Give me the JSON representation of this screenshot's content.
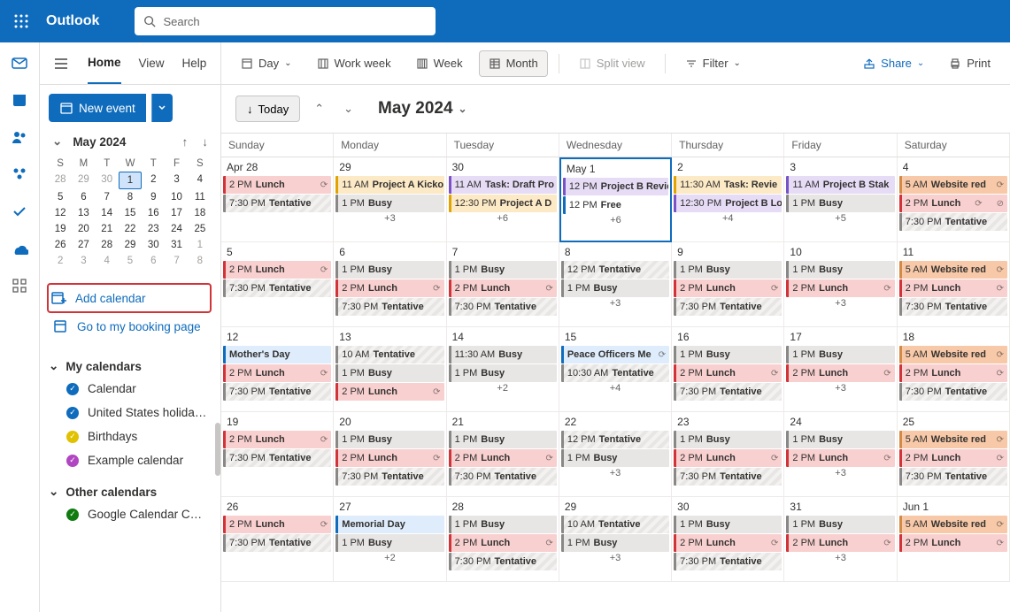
{
  "header": {
    "app_name": "Outlook",
    "search_placeholder": "Search"
  },
  "tabs": {
    "home": "Home",
    "view": "View",
    "help": "Help"
  },
  "side": {
    "new_event": "New event",
    "mini_title": "May 2024",
    "dow": [
      "S",
      "M",
      "T",
      "W",
      "T",
      "F",
      "S"
    ],
    "mini_days": [
      {
        "n": "28",
        "o": true
      },
      {
        "n": "29",
        "o": true
      },
      {
        "n": "30",
        "o": true
      },
      {
        "n": "1",
        "t": true
      },
      {
        "n": "2"
      },
      {
        "n": "3"
      },
      {
        "n": "4"
      },
      {
        "n": "5"
      },
      {
        "n": "6"
      },
      {
        "n": "7"
      },
      {
        "n": "8"
      },
      {
        "n": "9"
      },
      {
        "n": "10"
      },
      {
        "n": "11"
      },
      {
        "n": "12"
      },
      {
        "n": "13"
      },
      {
        "n": "14"
      },
      {
        "n": "15"
      },
      {
        "n": "16"
      },
      {
        "n": "17"
      },
      {
        "n": "18"
      },
      {
        "n": "19"
      },
      {
        "n": "20"
      },
      {
        "n": "21"
      },
      {
        "n": "22"
      },
      {
        "n": "23"
      },
      {
        "n": "24"
      },
      {
        "n": "25"
      },
      {
        "n": "26"
      },
      {
        "n": "27"
      },
      {
        "n": "28"
      },
      {
        "n": "29"
      },
      {
        "n": "30"
      },
      {
        "n": "31"
      },
      {
        "n": "1",
        "o": true
      },
      {
        "n": "2",
        "o": true
      },
      {
        "n": "3",
        "o": true
      },
      {
        "n": "4",
        "o": true
      },
      {
        "n": "5",
        "o": true
      },
      {
        "n": "6",
        "o": true
      },
      {
        "n": "7",
        "o": true
      },
      {
        "n": "8",
        "o": true
      }
    ],
    "add_calendar": "Add calendar",
    "booking": "Go to my booking page",
    "my_cal_head": "My calendars",
    "cals": [
      {
        "label": "Calendar",
        "color": "#0F6CBD",
        "checked": true
      },
      {
        "label": "United States holida…",
        "color": "#0F6CBD",
        "checked": true
      },
      {
        "label": "Birthdays",
        "color": "#e0c200",
        "checked": true
      },
      {
        "label": "Example calendar",
        "color": "#b146c2",
        "checked": true
      }
    ],
    "other_cal_head": "Other calendars",
    "other": [
      {
        "label": "Google Calendar C…",
        "color": "#107c10",
        "checked": true
      }
    ]
  },
  "toolbar": {
    "day": "Day",
    "work_week": "Work week",
    "week": "Week",
    "month": "Month",
    "split": "Split view",
    "filter": "Filter",
    "share": "Share",
    "print": "Print"
  },
  "month_head": {
    "today": "Today",
    "title": "May 2024"
  },
  "dow_full": [
    "Sunday",
    "Monday",
    "Tuesday",
    "Wednesday",
    "Thursday",
    "Friday",
    "Saturday"
  ],
  "weeks": [
    [
      {
        "num": "Apr 28",
        "ev": [
          {
            "t": "2 PM",
            "l": "Lunch",
            "c": "p-red",
            "r": true
          },
          {
            "t": "7:30 PM",
            "l": "Tentative",
            "c": "p-hash"
          }
        ]
      },
      {
        "num": "29",
        "ev": [
          {
            "t": "11 AM",
            "l": "Project A Kicko",
            "c": "p-amber"
          },
          {
            "t": "1 PM",
            "l": "Busy",
            "c": "p-grey"
          }
        ],
        "more": "+3"
      },
      {
        "num": "30",
        "ev": [
          {
            "t": "11 AM",
            "l": "Task: Draft Pro",
            "c": "p-purple"
          },
          {
            "t": "12:30 PM",
            "l": "Project A D",
            "c": "p-amber"
          }
        ],
        "more": "+6"
      },
      {
        "num": "May 1",
        "today": true,
        "ev": [
          {
            "t": "12 PM",
            "l": "Project B Revie",
            "c": "p-purple"
          },
          {
            "t": "12 PM",
            "l": "Free",
            "c": "p-bluebar"
          }
        ],
        "more": "+6"
      },
      {
        "num": "2",
        "ev": [
          {
            "t": "11:30 AM",
            "l": "Task: Revie",
            "c": "p-amber"
          },
          {
            "t": "12:30 PM",
            "l": "Project B Lo",
            "c": "p-purple"
          }
        ],
        "more": "+4"
      },
      {
        "num": "3",
        "ev": [
          {
            "t": "11 AM",
            "l": "Project B Stak",
            "c": "p-purple"
          },
          {
            "t": "1 PM",
            "l": "Busy",
            "c": "p-grey"
          }
        ],
        "more": "+5"
      },
      {
        "num": "4",
        "ev": [
          {
            "t": "5 AM",
            "l": "Website red",
            "c": "p-orange",
            "r": true
          },
          {
            "t": "2 PM",
            "l": "Lunch",
            "c": "p-red",
            "r": true,
            "x": true
          },
          {
            "t": "7:30 PM",
            "l": "Tentative",
            "c": "p-hash"
          }
        ]
      }
    ],
    [
      {
        "num": "5",
        "ev": [
          {
            "t": "2 PM",
            "l": "Lunch",
            "c": "p-red",
            "r": true
          },
          {
            "t": "7:30 PM",
            "l": "Tentative",
            "c": "p-hash"
          }
        ]
      },
      {
        "num": "6",
        "ev": [
          {
            "t": "1 PM",
            "l": "Busy",
            "c": "p-grey"
          },
          {
            "t": "2 PM",
            "l": "Lunch",
            "c": "p-red",
            "r": true
          },
          {
            "t": "7:30 PM",
            "l": "Tentative",
            "c": "p-hash"
          }
        ]
      },
      {
        "num": "7",
        "ev": [
          {
            "t": "1 PM",
            "l": "Busy",
            "c": "p-grey"
          },
          {
            "t": "2 PM",
            "l": "Lunch",
            "c": "p-red",
            "r": true
          },
          {
            "t": "7:30 PM",
            "l": "Tentative",
            "c": "p-hash"
          }
        ]
      },
      {
        "num": "8",
        "ev": [
          {
            "t": "12 PM",
            "l": "Tentative",
            "c": "p-hash"
          },
          {
            "t": "1 PM",
            "l": "Busy",
            "c": "p-grey"
          }
        ],
        "more": "+3"
      },
      {
        "num": "9",
        "ev": [
          {
            "t": "1 PM",
            "l": "Busy",
            "c": "p-grey"
          },
          {
            "t": "2 PM",
            "l": "Lunch",
            "c": "p-red",
            "r": true
          },
          {
            "t": "7:30 PM",
            "l": "Tentative",
            "c": "p-hash"
          }
        ]
      },
      {
        "num": "10",
        "ev": [
          {
            "t": "1 PM",
            "l": "Busy",
            "c": "p-grey"
          },
          {
            "t": "2 PM",
            "l": "Lunch",
            "c": "p-red",
            "r": true
          }
        ],
        "more": "+3"
      },
      {
        "num": "11",
        "ev": [
          {
            "t": "5 AM",
            "l": "Website red",
            "c": "p-orange",
            "r": true
          },
          {
            "t": "2 PM",
            "l": "Lunch",
            "c": "p-red",
            "r": true
          },
          {
            "t": "7:30 PM",
            "l": "Tentative",
            "c": "p-hash"
          }
        ]
      }
    ],
    [
      {
        "num": "12",
        "ev": [
          {
            "t": "",
            "l": "Mother's Day",
            "c": "p-blue"
          },
          {
            "t": "2 PM",
            "l": "Lunch",
            "c": "p-red",
            "r": true
          },
          {
            "t": "7:30 PM",
            "l": "Tentative",
            "c": "p-hash"
          }
        ]
      },
      {
        "num": "13",
        "ev": [
          {
            "t": "10 AM",
            "l": "Tentative",
            "c": "p-hash"
          },
          {
            "t": "1 PM",
            "l": "Busy",
            "c": "p-grey"
          },
          {
            "t": "2 PM",
            "l": "Lunch",
            "c": "p-red",
            "r": true
          }
        ]
      },
      {
        "num": "14",
        "ev": [
          {
            "t": "11:30 AM",
            "l": "Busy",
            "c": "p-grey"
          },
          {
            "t": "1 PM",
            "l": "Busy",
            "c": "p-grey"
          }
        ],
        "more": "+2"
      },
      {
        "num": "15",
        "ev": [
          {
            "t": "",
            "l": "Peace Officers Me",
            "c": "p-blue",
            "r": true
          },
          {
            "t": "10:30 AM",
            "l": "Tentative",
            "c": "p-hash"
          }
        ],
        "more": "+4"
      },
      {
        "num": "16",
        "ev": [
          {
            "t": "1 PM",
            "l": "Busy",
            "c": "p-grey"
          },
          {
            "t": "2 PM",
            "l": "Lunch",
            "c": "p-red",
            "r": true
          },
          {
            "t": "7:30 PM",
            "l": "Tentative",
            "c": "p-hash"
          }
        ]
      },
      {
        "num": "17",
        "ev": [
          {
            "t": "1 PM",
            "l": "Busy",
            "c": "p-grey"
          },
          {
            "t": "2 PM",
            "l": "Lunch",
            "c": "p-red",
            "r": true
          }
        ],
        "more": "+3"
      },
      {
        "num": "18",
        "ev": [
          {
            "t": "5 AM",
            "l": "Website red",
            "c": "p-orange",
            "r": true
          },
          {
            "t": "2 PM",
            "l": "Lunch",
            "c": "p-red",
            "r": true
          },
          {
            "t": "7:30 PM",
            "l": "Tentative",
            "c": "p-hash"
          }
        ]
      }
    ],
    [
      {
        "num": "19",
        "ev": [
          {
            "t": "2 PM",
            "l": "Lunch",
            "c": "p-red",
            "r": true
          },
          {
            "t": "7:30 PM",
            "l": "Tentative",
            "c": "p-hash"
          }
        ]
      },
      {
        "num": "20",
        "ev": [
          {
            "t": "1 PM",
            "l": "Busy",
            "c": "p-grey"
          },
          {
            "t": "2 PM",
            "l": "Lunch",
            "c": "p-red",
            "r": true
          },
          {
            "t": "7:30 PM",
            "l": "Tentative",
            "c": "p-hash"
          }
        ]
      },
      {
        "num": "21",
        "ev": [
          {
            "t": "1 PM",
            "l": "Busy",
            "c": "p-grey"
          },
          {
            "t": "2 PM",
            "l": "Lunch",
            "c": "p-red",
            "r": true
          },
          {
            "t": "7:30 PM",
            "l": "Tentative",
            "c": "p-hash"
          }
        ]
      },
      {
        "num": "22",
        "ev": [
          {
            "t": "12 PM",
            "l": "Tentative",
            "c": "p-hash"
          },
          {
            "t": "1 PM",
            "l": "Busy",
            "c": "p-grey"
          }
        ],
        "more": "+3"
      },
      {
        "num": "23",
        "ev": [
          {
            "t": "1 PM",
            "l": "Busy",
            "c": "p-grey"
          },
          {
            "t": "2 PM",
            "l": "Lunch",
            "c": "p-red",
            "r": true
          },
          {
            "t": "7:30 PM",
            "l": "Tentative",
            "c": "p-hash"
          }
        ]
      },
      {
        "num": "24",
        "ev": [
          {
            "t": "1 PM",
            "l": "Busy",
            "c": "p-grey"
          },
          {
            "t": "2 PM",
            "l": "Lunch",
            "c": "p-red",
            "r": true
          }
        ],
        "more": "+3"
      },
      {
        "num": "25",
        "ev": [
          {
            "t": "5 AM",
            "l": "Website red",
            "c": "p-orange",
            "r": true
          },
          {
            "t": "2 PM",
            "l": "Lunch",
            "c": "p-red",
            "r": true
          },
          {
            "t": "7:30 PM",
            "l": "Tentative",
            "c": "p-hash"
          }
        ]
      }
    ],
    [
      {
        "num": "26",
        "ev": [
          {
            "t": "2 PM",
            "l": "Lunch",
            "c": "p-red",
            "r": true
          },
          {
            "t": "7:30 PM",
            "l": "Tentative",
            "c": "p-hash"
          }
        ]
      },
      {
        "num": "27",
        "ev": [
          {
            "t": "",
            "l": "Memorial Day",
            "c": "p-blue"
          },
          {
            "t": "1 PM",
            "l": "Busy",
            "c": "p-grey"
          }
        ],
        "more": "+2"
      },
      {
        "num": "28",
        "ev": [
          {
            "t": "1 PM",
            "l": "Busy",
            "c": "p-grey"
          },
          {
            "t": "2 PM",
            "l": "Lunch",
            "c": "p-red",
            "r": true
          },
          {
            "t": "7:30 PM",
            "l": "Tentative",
            "c": "p-hash"
          }
        ]
      },
      {
        "num": "29",
        "ev": [
          {
            "t": "10 AM",
            "l": "Tentative",
            "c": "p-hash"
          },
          {
            "t": "1 PM",
            "l": "Busy",
            "c": "p-grey"
          }
        ],
        "more": "+3"
      },
      {
        "num": "30",
        "ev": [
          {
            "t": "1 PM",
            "l": "Busy",
            "c": "p-grey"
          },
          {
            "t": "2 PM",
            "l": "Lunch",
            "c": "p-red",
            "r": true
          },
          {
            "t": "7:30 PM",
            "l": "Tentative",
            "c": "p-hash"
          }
        ]
      },
      {
        "num": "31",
        "ev": [
          {
            "t": "1 PM",
            "l": "Busy",
            "c": "p-grey"
          },
          {
            "t": "2 PM",
            "l": "Lunch",
            "c": "p-red",
            "r": true
          }
        ],
        "more": "+3"
      },
      {
        "num": "Jun 1",
        "ev": [
          {
            "t": "5 AM",
            "l": "Website red",
            "c": "p-orange",
            "r": true
          },
          {
            "t": "2 PM",
            "l": "Lunch",
            "c": "p-red",
            "r": true
          }
        ]
      }
    ]
  ]
}
